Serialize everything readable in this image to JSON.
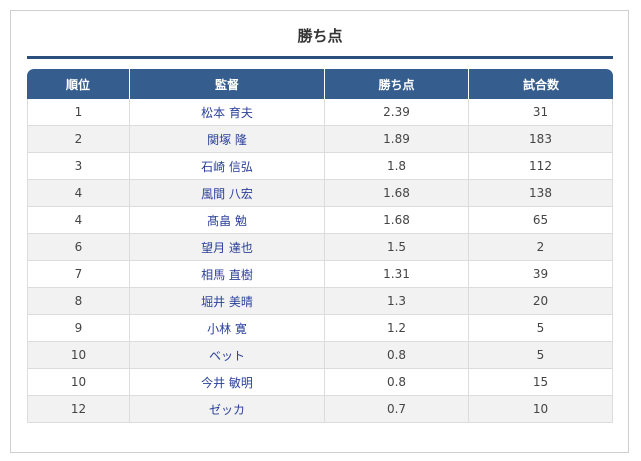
{
  "title": "勝ち点",
  "headers": {
    "rank": "順位",
    "manager": "監督",
    "points": "勝ち点",
    "games": "試合数"
  },
  "colors": {
    "header_bg": "#355d8e",
    "title_rule": "#2b4f7c",
    "link": "#2a3f9a",
    "row_alt": "#f2f2f2"
  },
  "rows": [
    {
      "rank": "1",
      "name": "松本 育夫",
      "points": "2.39",
      "games": "31"
    },
    {
      "rank": "2",
      "name": "関塚 隆",
      "points": "1.89",
      "games": "183"
    },
    {
      "rank": "3",
      "name": "石崎 信弘",
      "points": "1.8",
      "games": "112"
    },
    {
      "rank": "4",
      "name": "風間 八宏",
      "points": "1.68",
      "games": "138"
    },
    {
      "rank": "4",
      "name": "髙畠 勉",
      "points": "1.68",
      "games": "65"
    },
    {
      "rank": "6",
      "name": "望月 達也",
      "points": "1.5",
      "games": "2"
    },
    {
      "rank": "7",
      "name": "相馬 直樹",
      "points": "1.31",
      "games": "39"
    },
    {
      "rank": "8",
      "name": "堀井 美晴",
      "points": "1.3",
      "games": "20"
    },
    {
      "rank": "9",
      "name": "小林 寛",
      "points": "1.2",
      "games": "5"
    },
    {
      "rank": "10",
      "name": "ベット",
      "points": "0.8",
      "games": "5"
    },
    {
      "rank": "10",
      "name": "今井 敏明",
      "points": "0.8",
      "games": "15"
    },
    {
      "rank": "12",
      "name": "ゼッカ",
      "points": "0.7",
      "games": "10"
    }
  ]
}
